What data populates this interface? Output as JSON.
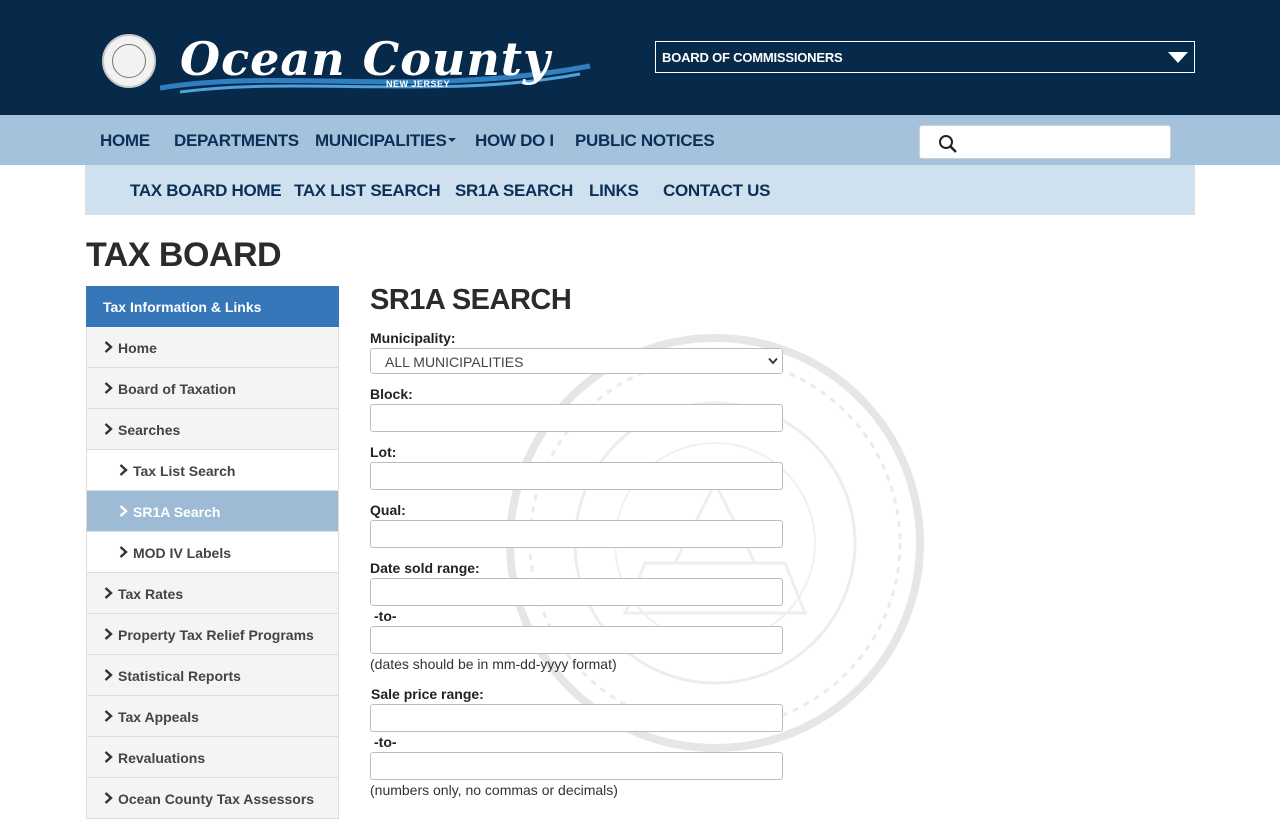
{
  "header": {
    "logo_text": "Ocean County",
    "logo_sub": "NEW JERSEY",
    "department_select": "BOARD OF COMMISSIONERS"
  },
  "main_nav": {
    "items": [
      {
        "label": "HOME"
      },
      {
        "label": "DEPARTMENTS"
      },
      {
        "label": "MUNICIPALITIES"
      },
      {
        "label": "HOW DO I"
      },
      {
        "label": "PUBLIC NOTICES"
      }
    ],
    "search_placeholder": ""
  },
  "sub_nav": {
    "items": [
      {
        "label": "TAX BOARD HOME"
      },
      {
        "label": "TAX LIST SEARCH"
      },
      {
        "label": "SR1A SEARCH"
      },
      {
        "label": "LINKS"
      },
      {
        "label": "CONTACT US"
      }
    ]
  },
  "page_title": "TAX BOARD",
  "sidebar": {
    "heading": "Tax Information & Links",
    "items": [
      {
        "label": "Home"
      },
      {
        "label": "Board of Taxation"
      },
      {
        "label": "Searches"
      },
      {
        "label": "Tax List Search"
      },
      {
        "label": "SR1A Search"
      },
      {
        "label": "MOD IV Labels"
      },
      {
        "label": "Tax Rates"
      },
      {
        "label": "Property Tax Relief Programs"
      },
      {
        "label": "Statistical Reports"
      },
      {
        "label": "Tax Appeals"
      },
      {
        "label": "Revaluations"
      },
      {
        "label": "Ocean County Tax Assessors"
      }
    ]
  },
  "form": {
    "title": "SR1A SEARCH",
    "municipality_label": "Municipality:",
    "municipality_value": "ALL MUNICIPALITIES",
    "block_label": "Block:",
    "lot_label": "Lot:",
    "qual_label": "Qual:",
    "date_label": "Date sold range:",
    "to_label": "-to-",
    "date_note": "(dates should be in mm-dd-yyyy format)",
    "price_label": "Sale price range:",
    "price_note": "(numbers only, no commas or decimals)"
  },
  "colors": {
    "header_bg": "#072a4a",
    "main_nav_bg": "#a4c2db",
    "sub_nav_bg": "#cfe1ee",
    "sidebar_head_bg": "#3577b9",
    "sidebar_active_bg": "#9dbbd4"
  }
}
